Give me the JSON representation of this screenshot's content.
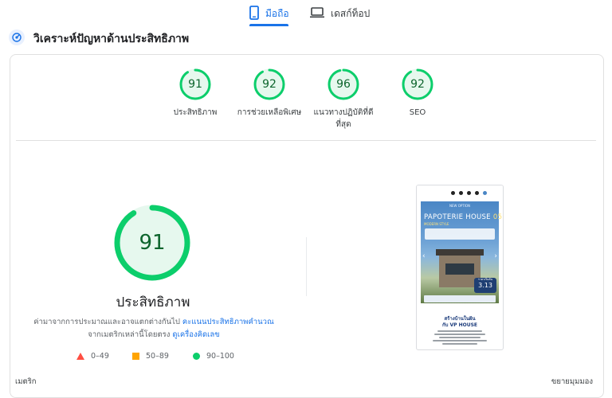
{
  "tabs": {
    "mobile": {
      "label": "มือถือ",
      "icon": "smartphone-icon",
      "active": true
    },
    "desktop": {
      "label": "เดสก์ท็อป",
      "icon": "desktop-icon",
      "active": false
    }
  },
  "section": {
    "title": "วิเคราะห์ปัญหาด้านประสิทธิภาพ",
    "icon": "performance-icon"
  },
  "scores": [
    {
      "value": "91",
      "label": "ประสิทธิภาพ",
      "fraction": 0.91
    },
    {
      "value": "92",
      "label": "การช่วยเหลือพิเศษ",
      "fraction": 0.92
    },
    {
      "value": "96",
      "label_line1": "แนวทางปฏิบัติที่ดี",
      "label_line2": "ที่สุด",
      "fraction": 0.96
    },
    {
      "value": "92",
      "label": "SEO",
      "fraction": 0.92
    }
  ],
  "main_score": {
    "value": "91",
    "fraction": 0.91,
    "title": "ประสิทธิภาพ"
  },
  "description": {
    "part1": "ค่ามาจากการประมาณและอาจแตกต่างกันไป ",
    "link1": "คะแนนประสิทธิภาพคำนวณ",
    "part2": "จากเมตริกเหล่านี้โดยตรง ",
    "link2": "ดูเครื่องคิดเลข"
  },
  "legend": {
    "fail": "0–49",
    "average": "50–89",
    "pass": "90–100"
  },
  "footer": {
    "metrics": "เมตริก",
    "expand": "ขยายมุมมอง"
  },
  "preview": {
    "hero_small": "NEW OPTION",
    "brand": "PAPOTERIE HOUSE",
    "brand_num": "05",
    "style": "MODERN STYLE",
    "price_label": "ราคาเริ่มต้น",
    "price": "3.13",
    "bottom_title_line1": "สร้างบ้านในฝัน",
    "bottom_title_line2": "กับ VP HOUSE"
  },
  "colors": {
    "pass": "#0cce6b",
    "pass_text": "#0d652d",
    "pass_bg": "#e6f8ee",
    "average": "#ffa400",
    "fail": "#ff4e42",
    "accent": "#1a73e8"
  }
}
